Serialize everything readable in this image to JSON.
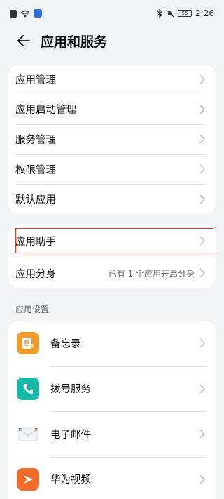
{
  "status_bar": {
    "time": "2:26",
    "battery": "55"
  },
  "header": {
    "title": "应用和服务"
  },
  "group1": {
    "items": [
      {
        "label": "应用管理"
      },
      {
        "label": "应用启动管理"
      },
      {
        "label": "服务管理"
      },
      {
        "label": "权限管理"
      },
      {
        "label": "默认应用"
      }
    ]
  },
  "group2": {
    "items": [
      {
        "label": "应用助手"
      },
      {
        "label": "应用分身",
        "value": "已有 1 个应用开启分身"
      }
    ]
  },
  "app_settings": {
    "section_label": "应用设置",
    "items": [
      {
        "label": "备忘录",
        "icon": "notepad-icon"
      },
      {
        "label": "拨号服务",
        "icon": "phone-icon"
      },
      {
        "label": "电子邮件",
        "icon": "email-icon"
      },
      {
        "label": "华为视频",
        "icon": "video-icon"
      }
    ]
  },
  "colors": {
    "highlight_border": "#e53935",
    "notepad": "#f39a2b",
    "phone": "#17b7a8",
    "video": "#f46a2b"
  }
}
